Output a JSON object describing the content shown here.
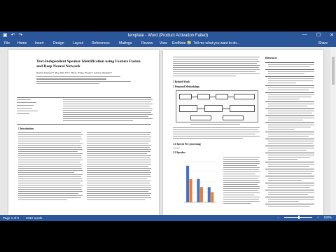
{
  "window": {
    "title": "template - Word (Product Activation Failed)",
    "min_glyph": "—",
    "max_glyph": "☐",
    "close_glyph": "✕",
    "accent": "#2b579a"
  },
  "quick_access": [
    "save-icon",
    "undo-icon",
    "redo-icon"
  ],
  "ribbon": {
    "tabs": [
      "File",
      "Home",
      "Insert",
      "Design",
      "Layout",
      "References",
      "Mailings",
      "Review",
      "View",
      "EndNote X9"
    ],
    "tell_me": "Tell me what you want to do...",
    "share": "Share"
  },
  "page1": {
    "title_line1": "Text-Independent Speaker Identification using Feature Fusion",
    "title_line2": "and Deep Neural Network",
    "authors": "Rashid Jahangir*, Ying Wah Teh*, Henry Friday Nweke*, Ghulam Mujtaba*",
    "intro_heading": "1   Introduction"
  },
  "page2": {
    "section2": "2   Related Work",
    "section3": "3   Proposed Methodology",
    "section31": "3.1   Speech Pre-processing",
    "section32": "3.2   Speaker",
    "references": "References"
  },
  "chart_data": {
    "type": "bar",
    "categories": [
      "",
      "",
      ""
    ],
    "series": [
      {
        "color": "#4472c4",
        "values": [
          72,
          46,
          30
        ]
      },
      {
        "color": "#ed7d31",
        "values": [
          46,
          30,
          20
        ]
      }
    ],
    "ylim": [
      0,
      80
    ],
    "grid": true
  },
  "statusbar": {
    "page": "Page 1 of 9",
    "words": "5342 words",
    "zoom": "100%"
  }
}
